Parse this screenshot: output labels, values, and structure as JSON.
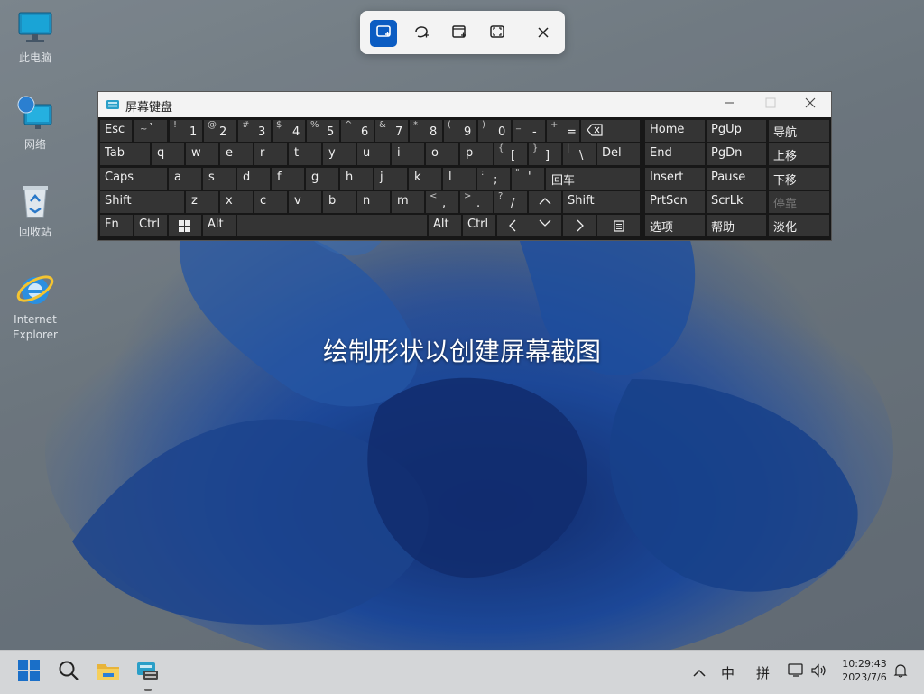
{
  "desktop": {
    "icons": [
      {
        "label": "此电脑"
      },
      {
        "label": "网络"
      },
      {
        "label": "回收站"
      },
      {
        "label": "Internet Explorer"
      }
    ]
  },
  "snip_toolbar": {
    "modes": [
      "rectangle-snip-icon",
      "freeform-snip-icon",
      "window-snip-icon",
      "fullscreen-snip-icon"
    ],
    "active_mode": "rectangle-snip-icon",
    "close": "close-icon",
    "accent": "#0b5cc2"
  },
  "keyboard": {
    "title": "屏幕键盘",
    "keys": {
      "esc": "Esc",
      "tilde": {
        "shift": "~",
        "main": "`"
      },
      "d1": {
        "shift": "!",
        "main": "1"
      },
      "d2": {
        "shift": "@",
        "main": "2"
      },
      "d3": {
        "shift": "#",
        "main": "3"
      },
      "d4": {
        "shift": "$",
        "main": "4"
      },
      "d5": {
        "shift": "%",
        "main": "5"
      },
      "d6": {
        "shift": "^",
        "main": "6"
      },
      "d7": {
        "shift": "&",
        "main": "7"
      },
      "d8": {
        "shift": "*",
        "main": "8"
      },
      "d9": {
        "shift": "(",
        "main": "9"
      },
      "d0": {
        "shift": ")",
        "main": "0"
      },
      "minus": {
        "shift": "_",
        "main": "-"
      },
      "equal": {
        "shift": "+",
        "main": "="
      },
      "tab": "Tab",
      "q": "q",
      "w": "w",
      "e": "e",
      "r": "r",
      "t": "t",
      "y": "y",
      "u": "u",
      "i": "i",
      "o": "o",
      "p": "p",
      "lbracket": {
        "shift": "{",
        "main": "["
      },
      "rbracket": {
        "shift": "}",
        "main": "]"
      },
      "backslash": {
        "shift": "|",
        "main": "\\"
      },
      "del": "Del",
      "caps": "Caps",
      "a": "a",
      "s": "s",
      "d": "d",
      "f": "f",
      "g": "g",
      "h": "h",
      "j": "j",
      "k": "k",
      "l": "l",
      "semicolon": {
        "shift": ":",
        "main": ";"
      },
      "quote": {
        "shift": "\"",
        "main": "'"
      },
      "enter": "回车",
      "shift_left": "Shift",
      "z": "z",
      "x": "x",
      "c": "c",
      "v": "v",
      "b": "b",
      "n": "n",
      "m": "m",
      "comma": {
        "shift": "<",
        "main": ","
      },
      "period": {
        "shift": ">",
        "main": "."
      },
      "slash": {
        "shift": "?",
        "main": "/"
      },
      "shift_right": "Shift",
      "fn": "Fn",
      "ctrl_left": "Ctrl",
      "alt_left": "Alt",
      "alt_right": "Alt",
      "ctrl_right": "Ctrl",
      "home": "Home",
      "pgup": "PgUp",
      "nav": "导航",
      "end": "End",
      "pgdn": "PgDn",
      "move_up": "上移",
      "insert": "Insert",
      "pause": "Pause",
      "move_down": "下移",
      "prtscn": "PrtScn",
      "scrlk": "ScrLk",
      "dock": "停靠",
      "options": "选项",
      "help": "帮助",
      "fade": "淡化"
    }
  },
  "caption": "绘制形状以创建屏幕截图",
  "taskbar": {
    "apps": [
      "start-icon",
      "search-icon",
      "file-explorer-icon",
      "on-screen-keyboard-icon"
    ],
    "tray": {
      "ime_mode": "中",
      "ime_name": "拼"
    },
    "clock": {
      "time": "10:29:43",
      "date": "2023/7/6"
    }
  }
}
